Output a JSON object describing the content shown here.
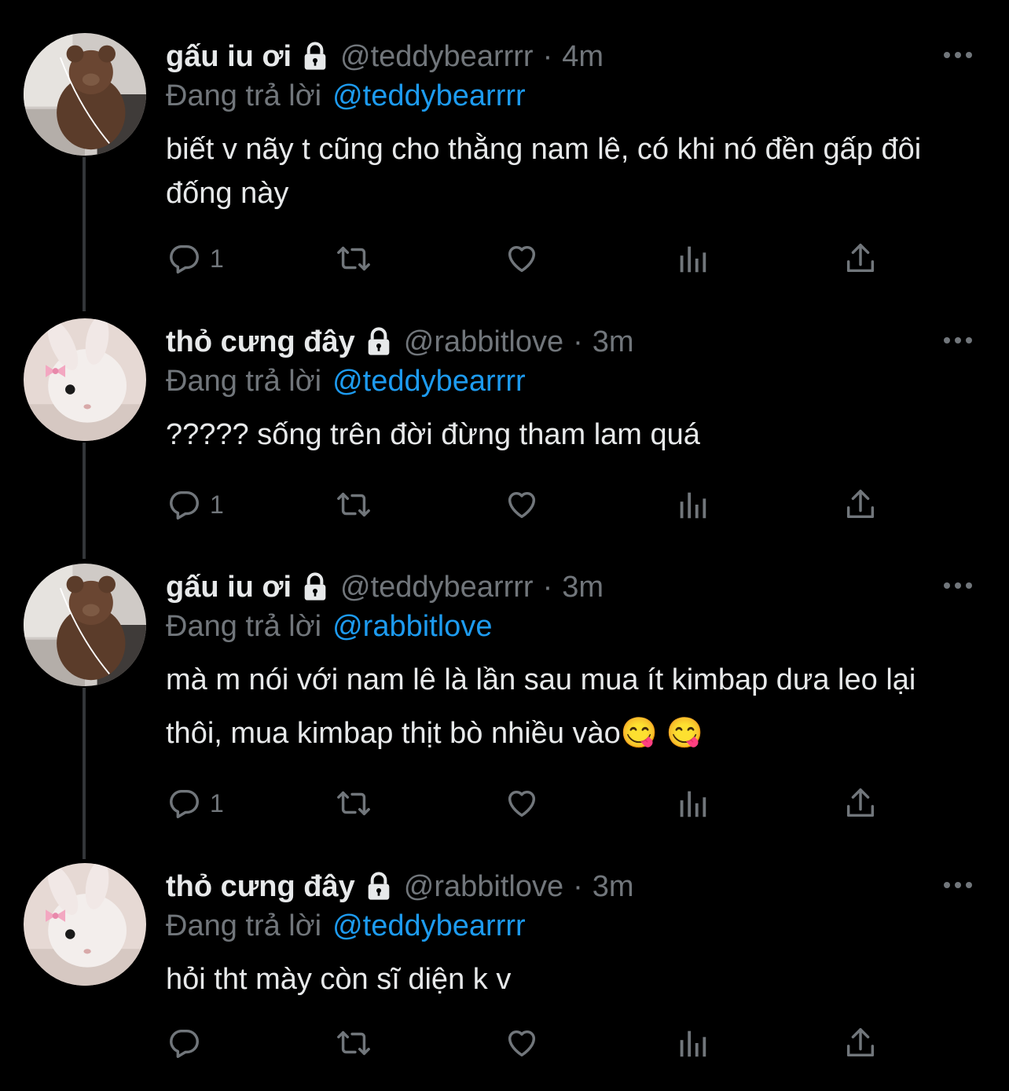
{
  "colors": {
    "background": "#000000",
    "text": "#e7e9ea",
    "secondary": "#71767b",
    "link": "#1d9bf0"
  },
  "tweets": [
    {
      "avatar": "teddy-bear-avatar",
      "name": "gấu iu ơi",
      "handle": "@teddybearrrr",
      "time": "4m",
      "dot": "·",
      "reply_label": "Đang trả lời",
      "reply_to": "@teddybearrrr",
      "text": "biết v nãy t cũng cho thằng nam lê, có khi nó đền gấp đôi đống này",
      "reply_count": "1"
    },
    {
      "avatar": "bunny-avatar",
      "name": "thỏ cưng đây",
      "handle": "@rabbitlove",
      "time": "3m",
      "dot": "·",
      "reply_label": "Đang trả lời",
      "reply_to": "@teddybearrrr",
      "text": "????? sống trên đời đừng tham lam quá",
      "reply_count": "1"
    },
    {
      "avatar": "teddy-bear-avatar",
      "name": "gấu iu ơi",
      "handle": "@teddybearrrr",
      "time": "3m",
      "dot": "·",
      "reply_label": "Đang trả lời",
      "reply_to": "@rabbitlove",
      "text": "mà m nói với nam lê là lần sau mua ít kimbap dưa leo lại thôi, mua kimbap thịt bò nhiều vào😋 😋",
      "reply_count": "1"
    },
    {
      "avatar": "bunny-avatar",
      "name": "thỏ cưng đây",
      "handle": "@rabbitlove",
      "time": "3m",
      "dot": "·",
      "reply_label": "Đang trả lời",
      "reply_to": "@teddybearrrr",
      "text": "hỏi tht mày còn sĩ diện k v",
      "reply_count": ""
    }
  ]
}
